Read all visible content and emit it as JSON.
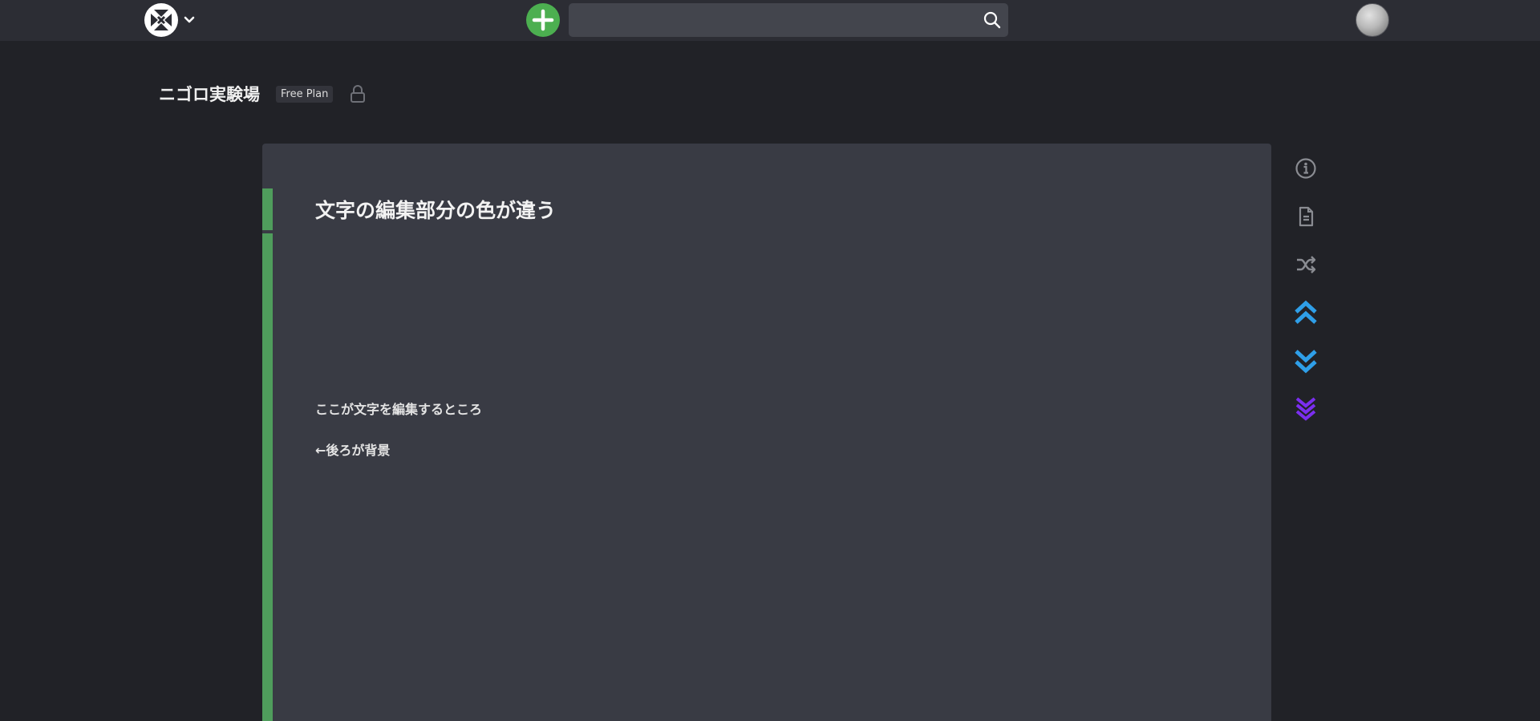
{
  "navbar": {
    "brand_icon": "scrapbox-logo-icon",
    "new_page_icon": "plus-circle-icon",
    "search": {
      "value": "",
      "placeholder": ""
    },
    "search_icon": "magnifier-icon",
    "avatar_icon": "user-avatar"
  },
  "project": {
    "title": "ニゴロ実験場",
    "plan_badge": "Free Plan",
    "lock_icon": "lock-icon"
  },
  "page": {
    "title": "文字の編集部分の色が違う",
    "lines": [
      "ここが文字を編集するところ",
      "←後ろが背景"
    ]
  },
  "side_tools": [
    {
      "name": "info-icon",
      "color": "#8a8c92"
    },
    {
      "name": "document-icon",
      "color": "#8a8c92"
    },
    {
      "name": "shuffle-icon",
      "color": "#8a8c92"
    },
    {
      "name": "scroll-top-icon",
      "color": "#2f9fe8"
    },
    {
      "name": "scroll-bottom-icon",
      "color": "#2f9fe8"
    },
    {
      "name": "jump-end-icon",
      "color": "#7b2ef0"
    }
  ],
  "colors": {
    "background": "#212227",
    "navbar": "#2c2d34",
    "card": "#393b44",
    "line_bar": "#4f9d5c",
    "accent_green": "#4caf50"
  }
}
